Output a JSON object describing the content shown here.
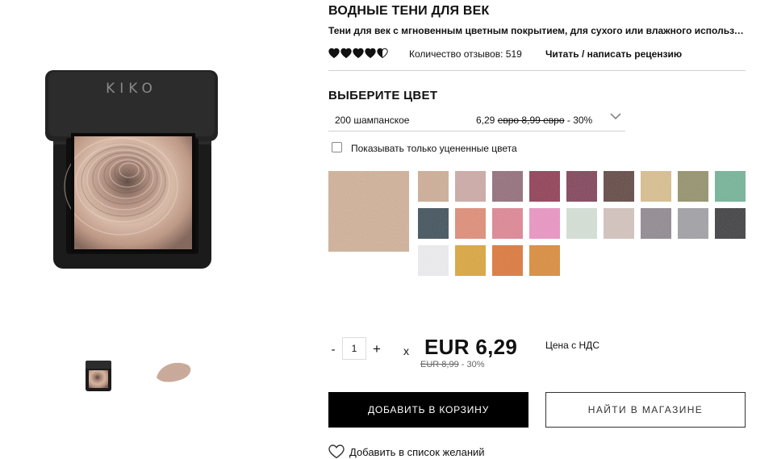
{
  "product": {
    "title": "ВОДНЫЕ ТЕНИ ДЛЯ ВЕК",
    "subtitle": "Тени для век с мгновенным цветным покрытием, для сухого или влажного использования",
    "rating": 4.5,
    "rating_max": 5,
    "reviews_text": "Количество отзывов: 519",
    "reviews_link": "Читать / написать рецензию",
    "brand_logo": "KIKO MILANO"
  },
  "color_select": {
    "heading": "ВЫБЕРИТЕ ЦВЕТ",
    "selected_name": "200 шампанское",
    "price": "6,29",
    "old_price": "евро 8,99 евро",
    "discount": "- 30%",
    "chevron_icon": "chevron-down-icon"
  },
  "filter": {
    "label": "Показывать только уцененные цвета",
    "checked": false
  },
  "selected_swatch_color": "#c7a78e",
  "swatches": [
    "#c8a892",
    "#c7a4a0",
    "#8e6a76",
    "#8c3b52",
    "#7e4056",
    "#5f4541",
    "#d3b98a",
    "#8f8d67",
    "#6fae92",
    "#3d4d57",
    "#d98873",
    "#d8818f",
    "#e48fbd",
    "#cfdad0",
    "#cdbdb7",
    "#8c848b",
    "#9b9ba0",
    "#3c3c3e",
    "#e7e7e9",
    "#d5a03a",
    "#d67438",
    "#d48738"
  ],
  "purchase": {
    "qty_minus": "-",
    "qty_value": "1",
    "qty_plus": "+",
    "times": "x",
    "price": "EUR 6,29",
    "vat": "Цена с НДС",
    "old_price": "EUR 8,99",
    "discount": "- 30%",
    "add_to_cart": "ДОБАВИТЬ В КОРЗИНУ",
    "find_in_store": "НАЙТИ В МАГАЗИНЕ",
    "wishlist": "Добавить в список желаний",
    "wishlist_icon": "heart-outline-icon"
  },
  "colors": {
    "primary_button_bg": "#000000",
    "text": "#111111",
    "divider": "#cfcfcf"
  }
}
